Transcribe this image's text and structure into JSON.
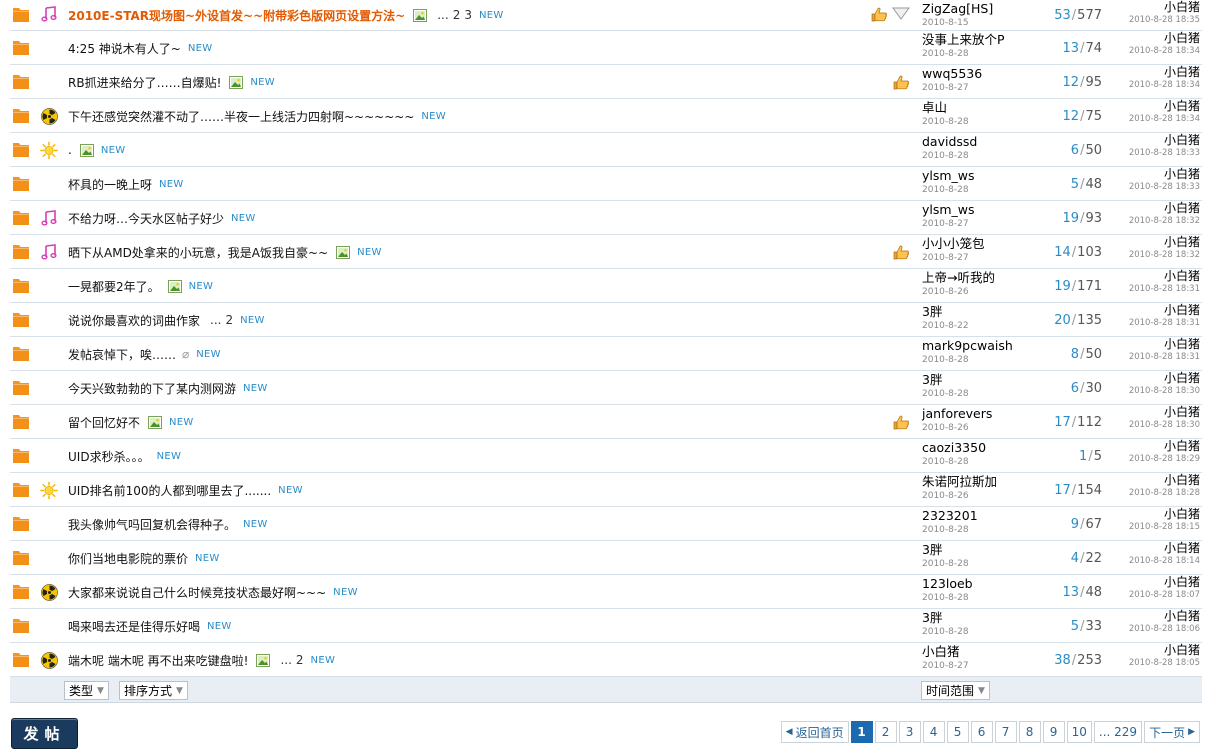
{
  "threads": [
    {
      "icon": "music-icon",
      "title": "2010E-STAR现场图~外设首发~~附带彩色版网页设置方法~",
      "hot": true,
      "has_image": true,
      "has_attach": false,
      "pages": [
        "2",
        "3"
      ],
      "hand": true,
      "heart": true,
      "author": "ZigZag[HS]",
      "author_date": "2010-8-15",
      "replies": "53",
      "views": "577",
      "last_author": "小白猪",
      "last_date": "2010-8-28 18:35"
    },
    {
      "icon": "",
      "title": "4:25 神说木有人了~",
      "hot": false,
      "has_image": false,
      "has_attach": false,
      "pages": [],
      "hand": false,
      "heart": false,
      "author": "没事上来放个P",
      "author_date": "2010-8-28",
      "replies": "13",
      "views": "74",
      "last_author": "小白猪",
      "last_date": "2010-8-28 18:34"
    },
    {
      "icon": "",
      "title": "RB抓进来给分了……自爆贴!",
      "hot": false,
      "has_image": true,
      "has_attach": false,
      "pages": [],
      "hand": true,
      "heart": false,
      "author": "wwq5536",
      "author_date": "2010-8-27",
      "replies": "12",
      "views": "95",
      "last_author": "小白猪",
      "last_date": "2010-8-28 18:34"
    },
    {
      "icon": "radiation-icon",
      "title": "下午还感觉突然灌不动了……半夜一上线活力四射啊~~~~~~~",
      "hot": false,
      "has_image": false,
      "has_attach": false,
      "pages": [],
      "hand": false,
      "heart": false,
      "author": "卓山",
      "author_date": "2010-8-28",
      "replies": "12",
      "views": "75",
      "last_author": "小白猪",
      "last_date": "2010-8-28 18:34"
    },
    {
      "icon": "sun-icon",
      "title": ".",
      "hot": false,
      "has_image": true,
      "has_attach": false,
      "pages": [],
      "hand": false,
      "heart": false,
      "author": "davidssd",
      "author_date": "2010-8-28",
      "replies": "6",
      "views": "50",
      "last_author": "小白猪",
      "last_date": "2010-8-28 18:33"
    },
    {
      "icon": "",
      "title": "杯具的一晚上呀",
      "hot": false,
      "has_image": false,
      "has_attach": false,
      "pages": [],
      "hand": false,
      "heart": false,
      "author": "ylsm_ws",
      "author_date": "2010-8-28",
      "replies": "5",
      "views": "48",
      "last_author": "小白猪",
      "last_date": "2010-8-28 18:33"
    },
    {
      "icon": "music-icon",
      "title": "不给力呀…今天水区帖子好少",
      "hot": false,
      "has_image": false,
      "has_attach": false,
      "pages": [],
      "hand": false,
      "heart": false,
      "author": "ylsm_ws",
      "author_date": "2010-8-27",
      "replies": "19",
      "views": "93",
      "last_author": "小白猪",
      "last_date": "2010-8-28 18:32"
    },
    {
      "icon": "music-icon",
      "title": "晒下从AMD处拿来的小玩意，我是A饭我自豪~~",
      "hot": false,
      "has_image": true,
      "has_attach": false,
      "pages": [],
      "hand": true,
      "heart": false,
      "author": "小小小笼包",
      "author_date": "2010-8-27",
      "replies": "14",
      "views": "103",
      "last_author": "小白猪",
      "last_date": "2010-8-28 18:32"
    },
    {
      "icon": "",
      "title": "一晃都要2年了。",
      "hot": false,
      "has_image": true,
      "has_attach": false,
      "pages": [],
      "hand": false,
      "heart": false,
      "author": "上帝→听我的",
      "author_date": "2010-8-26",
      "replies": "19",
      "views": "171",
      "last_author": "小白猪",
      "last_date": "2010-8-28 18:31"
    },
    {
      "icon": "",
      "title": "说说你最喜欢的词曲作家",
      "hot": false,
      "has_image": false,
      "has_attach": false,
      "pages": [
        "2"
      ],
      "hand": false,
      "heart": false,
      "author": "3胖",
      "author_date": "2010-8-22",
      "replies": "20",
      "views": "135",
      "last_author": "小白猪",
      "last_date": "2010-8-28 18:31"
    },
    {
      "icon": "",
      "title": "发帖哀悼下，唉……",
      "hot": false,
      "has_image": false,
      "has_attach": true,
      "pages": [],
      "hand": false,
      "heart": false,
      "author": "mark9pcwaish",
      "author_date": "2010-8-28",
      "replies": "8",
      "views": "50",
      "last_author": "小白猪",
      "last_date": "2010-8-28 18:31"
    },
    {
      "icon": "",
      "title": "今天兴致勃勃的下了某内测网游",
      "hot": false,
      "has_image": false,
      "has_attach": false,
      "pages": [],
      "hand": false,
      "heart": false,
      "author": "3胖",
      "author_date": "2010-8-28",
      "replies": "6",
      "views": "30",
      "last_author": "小白猪",
      "last_date": "2010-8-28 18:30"
    },
    {
      "icon": "",
      "title": "留个回忆好不",
      "hot": false,
      "has_image": true,
      "has_attach": false,
      "pages": [],
      "hand": true,
      "heart": false,
      "author": "janforevers",
      "author_date": "2010-8-26",
      "replies": "17",
      "views": "112",
      "last_author": "小白猪",
      "last_date": "2010-8-28 18:30"
    },
    {
      "icon": "",
      "title": "UID求秒杀。。。",
      "hot": false,
      "has_image": false,
      "has_attach": false,
      "pages": [],
      "hand": false,
      "heart": false,
      "author": "caozi3350",
      "author_date": "2010-8-28",
      "replies": "1",
      "views": "5",
      "last_author": "小白猪",
      "last_date": "2010-8-28 18:29"
    },
    {
      "icon": "sun-icon",
      "title": "UID排名前100的人都到哪里去了.......",
      "hot": false,
      "has_image": false,
      "has_attach": false,
      "pages": [],
      "hand": false,
      "heart": false,
      "author": "朱诺阿拉斯加",
      "author_date": "2010-8-26",
      "replies": "17",
      "views": "154",
      "last_author": "小白猪",
      "last_date": "2010-8-28 18:28"
    },
    {
      "icon": "",
      "title": "我头像帅气吗回复机会得种子。",
      "hot": false,
      "has_image": false,
      "has_attach": false,
      "pages": [],
      "hand": false,
      "heart": false,
      "author": "2323201",
      "author_date": "2010-8-28",
      "replies": "9",
      "views": "67",
      "last_author": "小白猪",
      "last_date": "2010-8-28 18:15"
    },
    {
      "icon": "",
      "title": "你们当地电影院的票价",
      "hot": false,
      "has_image": false,
      "has_attach": false,
      "pages": [],
      "hand": false,
      "heart": false,
      "author": "3胖",
      "author_date": "2010-8-28",
      "replies": "4",
      "views": "22",
      "last_author": "小白猪",
      "last_date": "2010-8-28 18:14"
    },
    {
      "icon": "radiation-icon",
      "title": "大家都来说说自己什么时候竞技状态最好啊~~~",
      "hot": false,
      "has_image": false,
      "has_attach": false,
      "pages": [],
      "hand": false,
      "heart": false,
      "author": "123loeb",
      "author_date": "2010-8-28",
      "replies": "13",
      "views": "48",
      "last_author": "小白猪",
      "last_date": "2010-8-28 18:07"
    },
    {
      "icon": "",
      "title": "喝来喝去还是佳得乐好喝",
      "hot": false,
      "has_image": false,
      "has_attach": false,
      "pages": [],
      "hand": false,
      "heart": false,
      "author": "3胖",
      "author_date": "2010-8-28",
      "replies": "5",
      "views": "33",
      "last_author": "小白猪",
      "last_date": "2010-8-28 18:06"
    },
    {
      "icon": "radiation-icon",
      "title": "端木呢 端木呢 再不出来吃键盘啦!",
      "hot": false,
      "has_image": true,
      "has_attach": false,
      "pages": [
        "2"
      ],
      "hand": false,
      "heart": false,
      "author": "小白猪",
      "author_date": "2010-8-27",
      "replies": "38",
      "views": "253",
      "last_author": "小白猪",
      "last_date": "2010-8-28 18:05"
    }
  ],
  "labels": {
    "new_badge": "NEW",
    "ellipsis": "...",
    "count_sep": "/"
  },
  "filters": {
    "type_label": "类型",
    "sort_label": "排序方式",
    "time_label": "时间范围"
  },
  "post_button": "发帖",
  "pager": {
    "back_label": "返回首页",
    "pages": [
      "1",
      "2",
      "3",
      "4",
      "5",
      "6",
      "7",
      "8",
      "9",
      "10"
    ],
    "current": "1",
    "last_label": "... 229",
    "next_label": "下一页"
  },
  "colors": {
    "folder": "#f7931e",
    "hot_title": "#e35b00",
    "link_blue": "#2a8cc6",
    "button_dark": "#1a3a5e"
  }
}
